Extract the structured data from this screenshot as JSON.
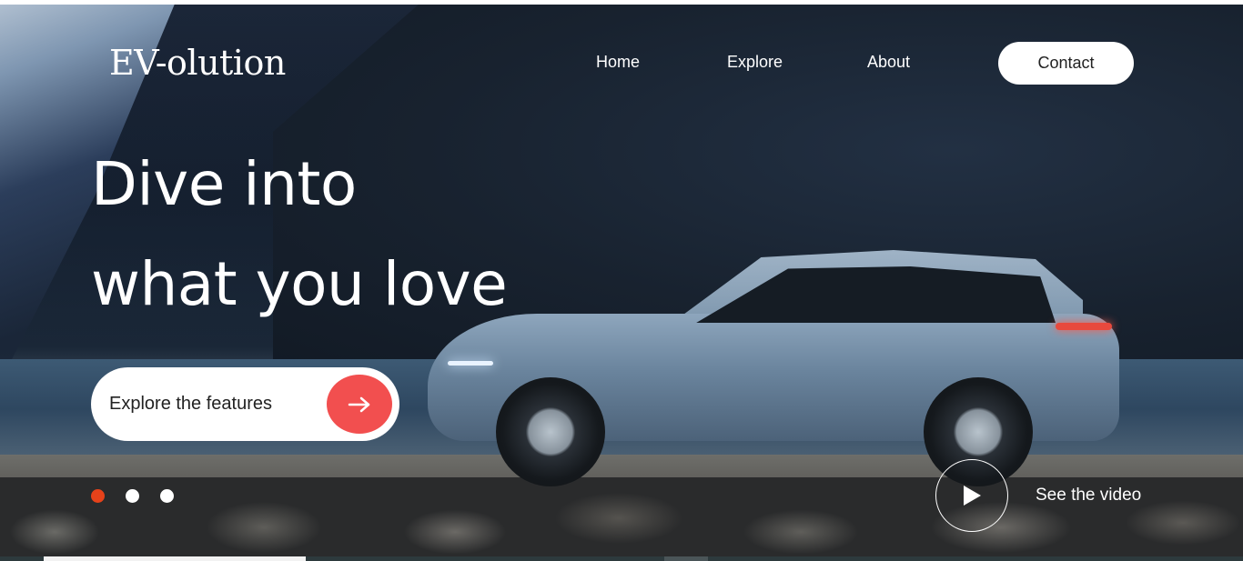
{
  "header": {
    "logo": "EV-olution",
    "nav": [
      "Home",
      "Explore",
      "About"
    ],
    "contact_label": "Contact"
  },
  "hero": {
    "headline_line1": "Dive into",
    "headline_line2": "what you love",
    "cta_label": "Explore the features",
    "cta_icon": "arrow-right-icon",
    "video_label": "See the video",
    "video_icon": "play-icon"
  },
  "carousel": {
    "dots": 3,
    "active_index": 0
  },
  "colors": {
    "accent": "#f24f4f",
    "active_dot": "#e6421a"
  }
}
